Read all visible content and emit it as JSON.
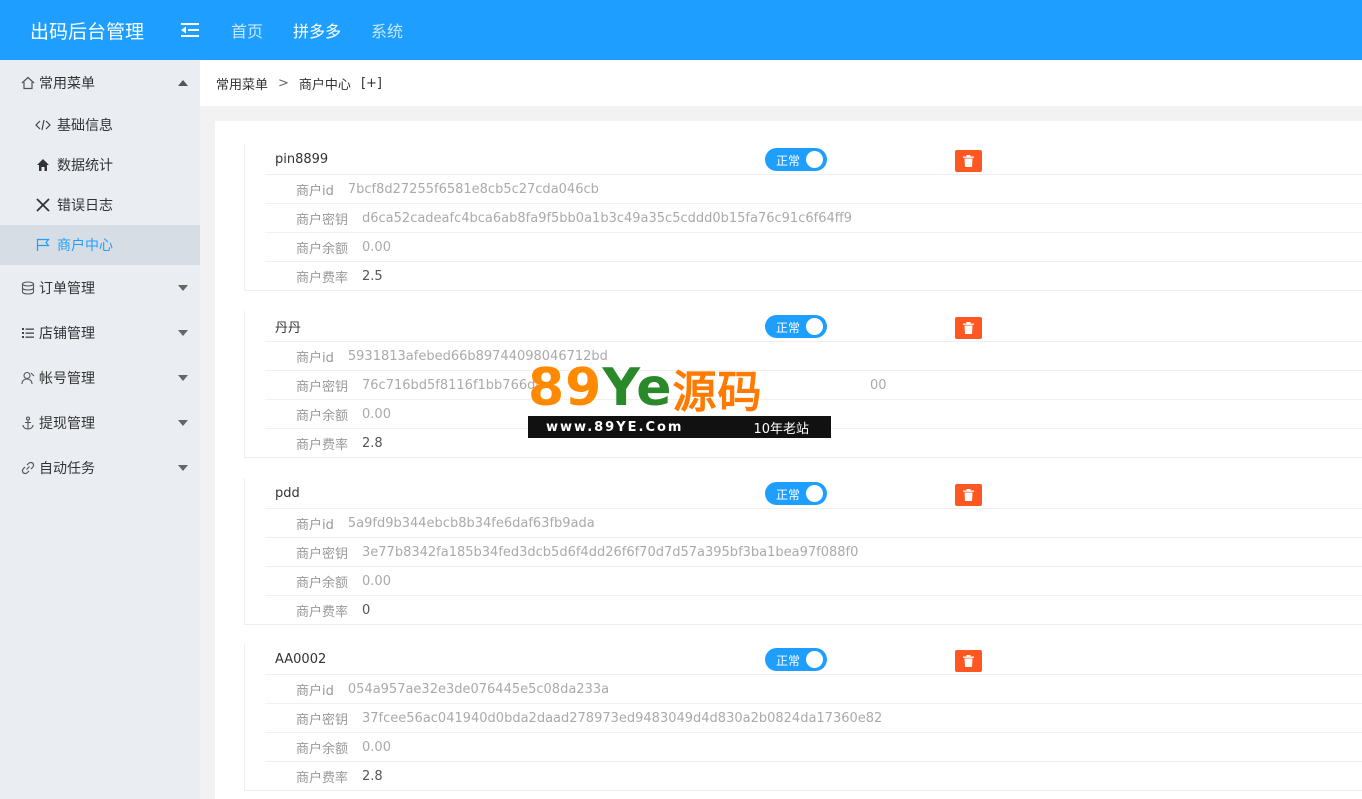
{
  "header": {
    "brand": "出码后台管理",
    "nav": [
      "首页",
      "拼多多",
      "系统"
    ]
  },
  "sidebar": {
    "groups": [
      {
        "label": "常用菜单",
        "icon": "home-icon",
        "expanded": true,
        "items": [
          {
            "label": "基础信息",
            "icon": "code-icon"
          },
          {
            "label": "数据统计",
            "icon": "house-icon"
          },
          {
            "label": "错误日志",
            "icon": "cross-icon"
          },
          {
            "label": "商户中心",
            "icon": "flag-icon",
            "active": true
          }
        ]
      },
      {
        "label": "订单管理",
        "icon": "database-icon"
      },
      {
        "label": "店铺管理",
        "icon": "list-icon"
      },
      {
        "label": "帐号管理",
        "icon": "user-icon"
      },
      {
        "label": "提现管理",
        "icon": "anchor-icon"
      },
      {
        "label": "自动任务",
        "icon": "link-icon"
      }
    ]
  },
  "breadcrumb": {
    "items": [
      "常用菜单",
      "商户中心"
    ],
    "separator": ">",
    "plus": "[+]"
  },
  "labels": {
    "id": "商户id",
    "key": "商户密钥",
    "balance": "商户余额",
    "rate": "商户费率",
    "status": "正常"
  },
  "merchants": [
    {
      "name": "pin8899",
      "id": "7bcf8d27255f6581e8cb5c27cda046cb",
      "key": "d6ca52cadeafc4bca6ab8fa9f5bb0a1b3c49a35c5cddd0b15fa76c91c6f64ff9",
      "balance": "0.00",
      "rate": "2.5"
    },
    {
      "name": "丹丹",
      "id": "5931813afebed66b89744098046712bd",
      "key": "76c716bd5f8116f1bb766d4",
      "key_tail": "00",
      "balance": "0.00",
      "rate": "2.8"
    },
    {
      "name": "pdd",
      "id": "5a9fd9b344ebcb8b34fe6daf63fb9ada",
      "key": "3e77b8342fa185b34fed3dcb5d6f4dd26f6f70d7d57a395bf3ba1bea97f088f0",
      "balance": "0.00",
      "rate": "0"
    },
    {
      "name": "AA0002",
      "id": "054a957ae32e3de076445e5c08da233a",
      "key": "37fcee56ac041940d0bda2daad278973ed9483049d4d830a2b0824da17360e82",
      "balance": "0.00",
      "rate": "2.8"
    }
  ],
  "watermark": {
    "logo_digits": "89",
    "logo_letters": "Ye",
    "logo_cn": "源码",
    "url": "www.89YE.Com",
    "tag": "10年老站"
  },
  "colors": {
    "header": "#1e9fff",
    "accent": "#1e9fff",
    "danger": "#ff5722",
    "sidebar_bg": "#eaedf1"
  }
}
